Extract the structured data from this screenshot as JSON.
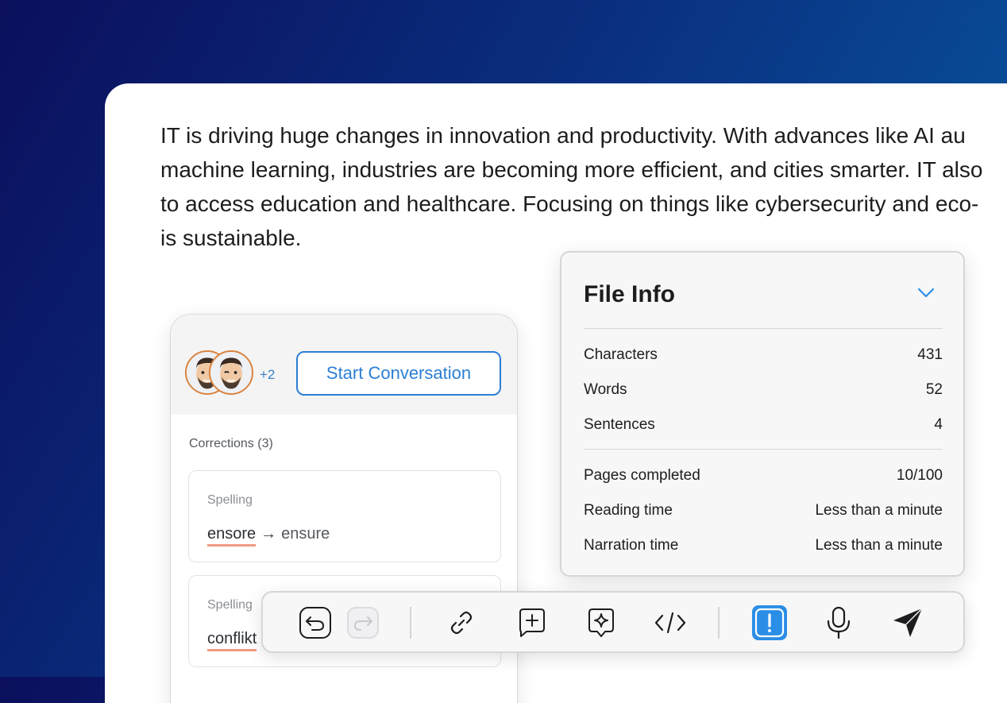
{
  "document": {
    "lines": [
      "IT is driving huge changes in innovation and productivity. With advances like AI au",
      "machine learning, industries are becoming more efficient, and cities smarter. IT also",
      "to access education and healthcare. Focusing on things like cybersecurity and eco-",
      "is sustainable."
    ]
  },
  "collaboration": {
    "extra_participants": "+2",
    "start_button": "Start Conversation",
    "corrections_title": "Corrections (3)",
    "corrections": [
      {
        "type": "Spelling",
        "wrong": "ensore",
        "arrow": "→",
        "right": "ensure"
      },
      {
        "type": "Spelling",
        "wrong": "conflikt",
        "arrow": "",
        "right": ""
      }
    ]
  },
  "file_info": {
    "title": "File Info",
    "stats": [
      {
        "label": "Characters",
        "value": "431"
      },
      {
        "label": "Words",
        "value": "52"
      },
      {
        "label": "Sentences",
        "value": "4"
      }
    ],
    "progress": [
      {
        "label": "Pages completed",
        "value": "10/100"
      },
      {
        "label": "Reading time",
        "value": "Less than a minute"
      },
      {
        "label": "Narration time",
        "value": "Less than a minute"
      }
    ]
  },
  "toolbar": {
    "icons": [
      "undo-icon",
      "redo-icon",
      "link-icon",
      "add-comment-icon",
      "ai-comment-icon",
      "code-icon",
      "alert-icon",
      "microphone-icon",
      "send-icon"
    ],
    "active": "alert-icon",
    "accent_color": "#2b8ee6"
  },
  "colors": {
    "accent": "#2b7fd4",
    "correction_underline": "#ef9b82",
    "avatar_border": "#d9823e"
  }
}
